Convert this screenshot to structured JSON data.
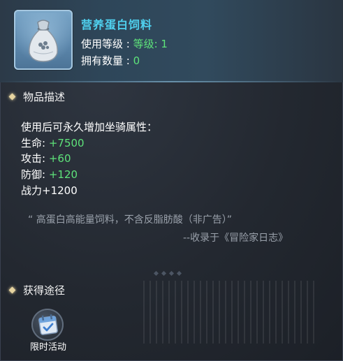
{
  "item": {
    "name": "营养蛋白饲料",
    "level_label": "使用等级 : ",
    "level_value": "等级: 1",
    "count_label": "拥有数量 : ",
    "count_value": "0"
  },
  "description": {
    "title": "物品描述",
    "intro": "使用后可永久增加坐骑属性：",
    "stats": [
      {
        "label": "生命: ",
        "value": "+7500",
        "value_color": "#5ee37a"
      },
      {
        "label": "攻击: ",
        "value": "+60",
        "value_color": "#5ee37a"
      },
      {
        "label": "防御: ",
        "value": "+120",
        "value_color": "#5ee37a"
      },
      {
        "label": "战力",
        "value": "+1200",
        "value_color": "#ffffff"
      }
    ],
    "quote": "“ 高蛋白高能量饲料，不含反脂肪酸（非广告）”",
    "source": "--收录于《冒险家日志》"
  },
  "obtain": {
    "title": "获得途径",
    "sources": [
      {
        "label": "限时活动",
        "icon": "calendar-check-icon"
      }
    ]
  },
  "colors": {
    "name": "#4fd0ee",
    "highlight_green": "#5ee37a",
    "quote_gray": "#9aa1ab"
  }
}
